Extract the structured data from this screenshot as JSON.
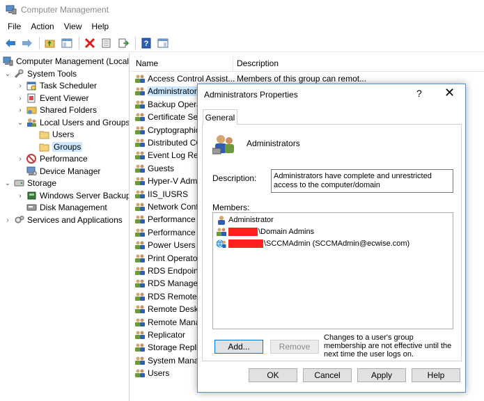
{
  "window": {
    "title": "Computer Management"
  },
  "menu": [
    "File",
    "Action",
    "View",
    "Help"
  ],
  "toolbar": [
    "back-arrow-icon",
    "forward-arrow-icon",
    "up-folder-icon",
    "show-hide-tree-icon",
    "delete-icon",
    "properties-icon",
    "export-icon",
    "help-icon",
    "show-action-pane-icon"
  ],
  "tree": {
    "root": "Computer Management (Local",
    "system_tools": "System Tools",
    "task_scheduler": "Task Scheduler",
    "event_viewer": "Event Viewer",
    "shared_folders": "Shared Folders",
    "local_users_groups": "Local Users and Groups",
    "users": "Users",
    "groups": "Groups",
    "performance": "Performance",
    "device_manager": "Device Manager",
    "storage": "Storage",
    "windows_server_backup": "Windows Server Backup",
    "disk_management": "Disk Management",
    "services_apps": "Services and Applications"
  },
  "list": {
    "col_name": "Name",
    "col_desc": "Description",
    "rows": [
      {
        "name": "Access Control Assist...",
        "desc": "Members of this group can remot..."
      },
      {
        "name": "Administrators",
        "desc": ""
      },
      {
        "name": "Backup Operat",
        "desc": ""
      },
      {
        "name": "Certificate Serv",
        "desc": ""
      },
      {
        "name": "Cryptographic",
        "desc": ""
      },
      {
        "name": "Distributed CO",
        "desc": ""
      },
      {
        "name": "Event Log Rea",
        "desc": ""
      },
      {
        "name": "Guests",
        "desc": ""
      },
      {
        "name": "Hyper-V Admi",
        "desc": ""
      },
      {
        "name": "IIS_IUSRS",
        "desc": ""
      },
      {
        "name": "Network Conf",
        "desc": ""
      },
      {
        "name": "Performance L",
        "desc": ""
      },
      {
        "name": "Performance M",
        "desc": ""
      },
      {
        "name": "Power Users",
        "desc": ""
      },
      {
        "name": "Print Operator",
        "desc": ""
      },
      {
        "name": "RDS Endpoint",
        "desc": ""
      },
      {
        "name": "RDS Managem",
        "desc": ""
      },
      {
        "name": "RDS Remote A",
        "desc": ""
      },
      {
        "name": "Remote Deskto",
        "desc": ""
      },
      {
        "name": "Remote Mana",
        "desc": ""
      },
      {
        "name": "Replicator",
        "desc": ""
      },
      {
        "name": "Storage Replic",
        "desc": ""
      },
      {
        "name": "System Manag",
        "desc": ""
      },
      {
        "name": "Users",
        "desc": ""
      }
    ]
  },
  "dialog": {
    "title": "Administrators Properties",
    "help": "?",
    "close": "✕",
    "tab": "General",
    "group_name": "Administrators",
    "description_label": "Description:",
    "description_value": "Administrators have complete and unrestricted access to the computer/domain",
    "members_label": "Members:",
    "members": [
      {
        "pre": "",
        "text": "Administrator"
      },
      {
        "pre": "",
        "text": "\\Domain Admins"
      },
      {
        "pre": "",
        "text": "\\SCCMAdmin (SCCMAdmin@ecwise.com)"
      }
    ],
    "add": "Add...",
    "remove": "Remove",
    "note": "Changes to a user's group membership are not effective until the next time the user logs on.",
    "ok": "OK",
    "cancel": "Cancel",
    "apply": "Apply",
    "help_btn": "Help"
  },
  "colors": {
    "selection": "#cce8ff",
    "accent": "#0078d7",
    "redaction": "#ff2020"
  }
}
